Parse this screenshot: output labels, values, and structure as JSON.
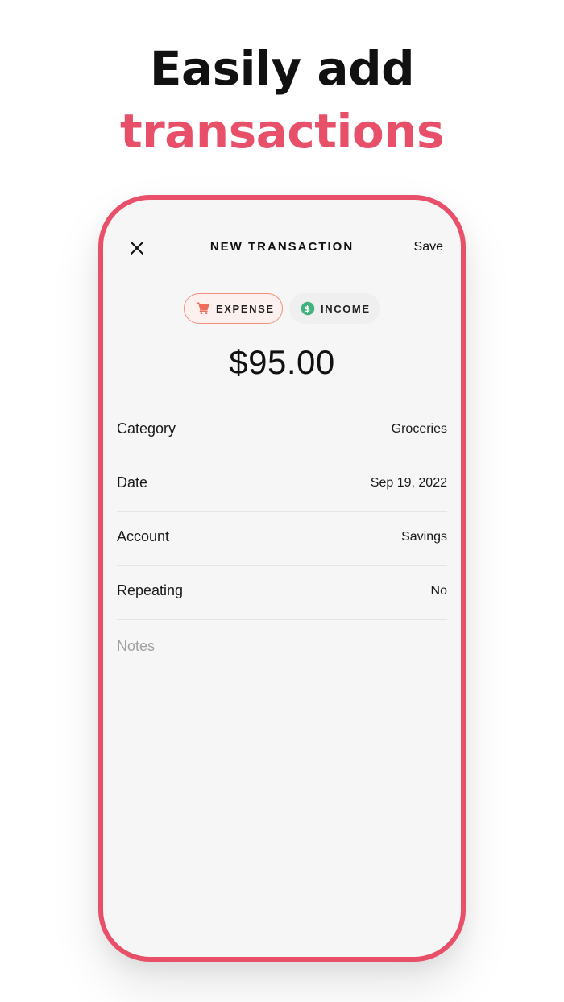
{
  "headline": {
    "line1": "Easily add",
    "line2": "transactions"
  },
  "colors": {
    "accent": "#e8506a",
    "expense_icon": "#f06d5a",
    "income_icon": "#43b27f"
  },
  "nav": {
    "close_icon": "close-icon",
    "title": "NEW TRANSACTION",
    "save_label": "Save"
  },
  "type_toggle": {
    "expense_label": "EXPENSE",
    "expense_icon": "shopping-cart-icon",
    "income_label": "INCOME",
    "income_icon": "dollar-circle-icon",
    "selected": "EXPENSE"
  },
  "amount": "$95.00",
  "fields": [
    {
      "label": "Category",
      "value": "Groceries"
    },
    {
      "label": "Date",
      "value": "Sep 19, 2022"
    },
    {
      "label": "Account",
      "value": "Savings"
    },
    {
      "label": "Repeating",
      "value": "No"
    }
  ],
  "notes": {
    "placeholder": "Notes",
    "value": ""
  }
}
